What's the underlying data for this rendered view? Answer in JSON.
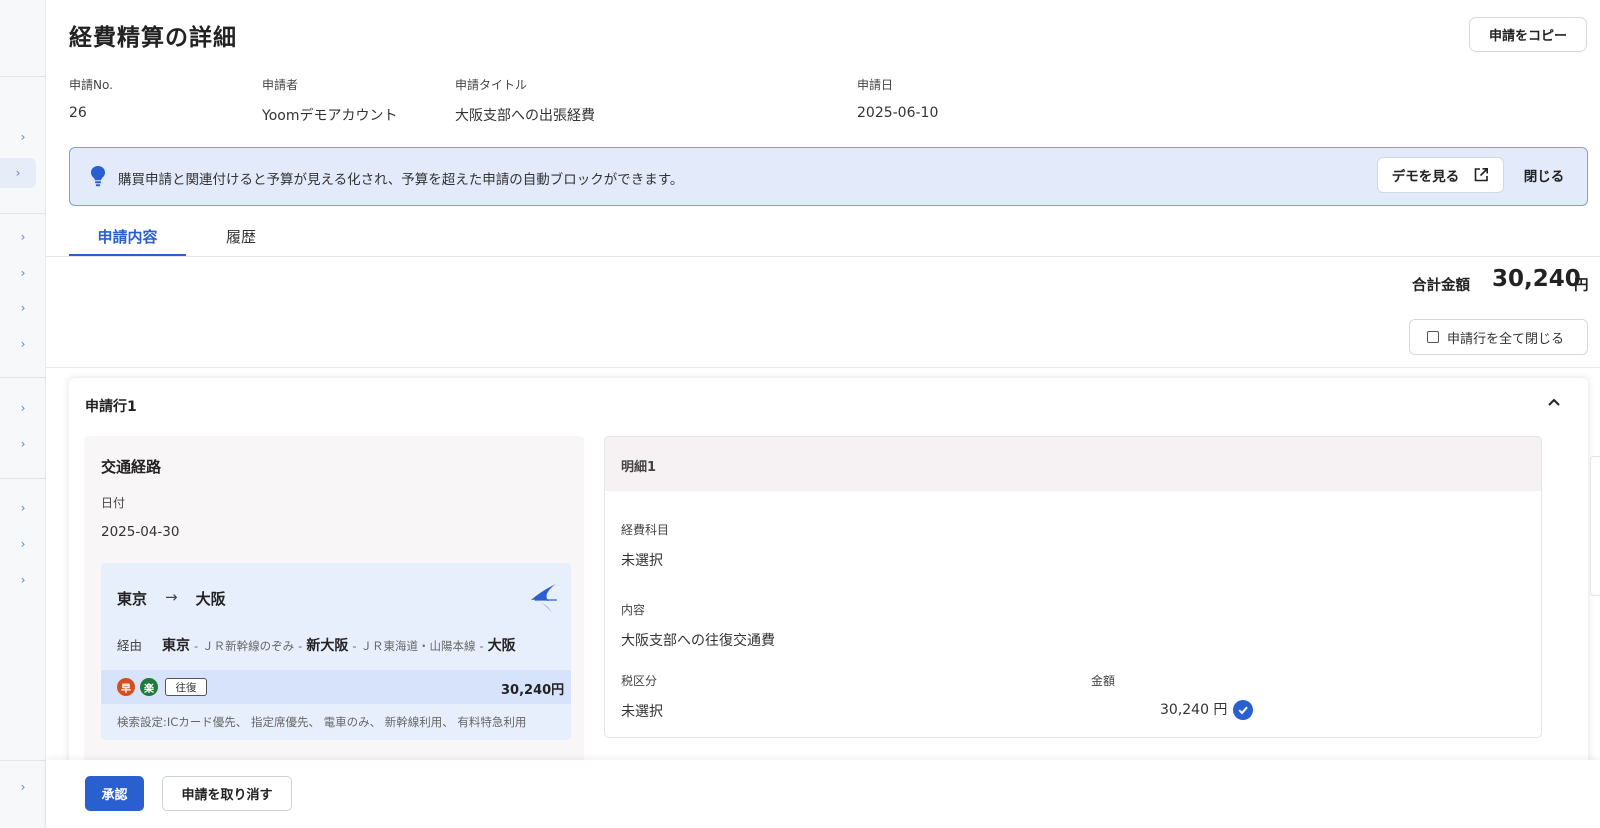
{
  "page": {
    "title": "経費精算の詳細",
    "copy_button": "申請をコピー"
  },
  "meta": {
    "request_no": {
      "label": "申請No.",
      "value": "26"
    },
    "applicant": {
      "label": "申請者",
      "value": "Yoomデモアカウント"
    },
    "request_title": {
      "label": "申請タイトル",
      "value": "大阪支部への出張経費"
    },
    "request_date": {
      "label": "申請日",
      "value": "2025-06-10"
    }
  },
  "banner": {
    "icon": "lightbulb-icon",
    "message": "購買申請と関連付けると予算が見える化され、予算を超えた申請の自動ブロックができます。",
    "demo_button": "デモを見る",
    "demo_icon": "external-link-icon",
    "close_button": "閉じる"
  },
  "tabs": [
    {
      "label": "申請内容",
      "active": true
    },
    {
      "label": "履歴",
      "active": false
    }
  ],
  "total": {
    "label": "合計金額",
    "value": "30,240",
    "unit": "円"
  },
  "collapse_all": {
    "label": "申請行を全て閉じる",
    "checked": false
  },
  "line_item": {
    "title": "申請行1",
    "route": {
      "title": "交通経路",
      "date_label": "日付",
      "date": "2025-04-30",
      "from": "東京",
      "arrow": "→",
      "to": "大阪",
      "via_label": "経由",
      "stations": [
        "東京",
        "新大阪",
        "大阪"
      ],
      "lines": [
        "ＪＲ新幹線のぞみ",
        "ＪＲ東海道・山陽本線"
      ],
      "dash": "-",
      "badges": [
        {
          "text": "早",
          "color": "#d2501e"
        },
        {
          "text": "楽",
          "color": "#1f7a3c"
        }
      ],
      "trip_tag": "往復",
      "fare": "30,240円",
      "settings": "検索設定:ICカード優先、 指定席優先、 電車のみ、 新幹線利用、 有料特急利用"
    },
    "detail": {
      "title": "明細1",
      "account_label": "経費科目",
      "account_value": "未選択",
      "content_label": "内容",
      "content_value": "大阪支部への往復交通費",
      "tax_label": "税区分",
      "tax_value": "未選択",
      "amount_label": "金額",
      "amount_value": "30,240 円"
    }
  },
  "actions": {
    "approve": "承認",
    "cancel": "申請を取り消す"
  },
  "colors": {
    "accent": "#2a5fd0",
    "banner_bg": "#e3ebfb",
    "banner_border": "#7ea0e0"
  }
}
